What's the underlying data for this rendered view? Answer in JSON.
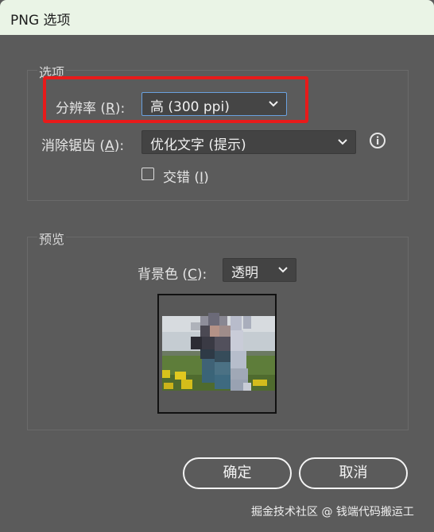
{
  "window": {
    "title": "PNG 选项"
  },
  "options": {
    "group_title": "选项",
    "resolution": {
      "label_prefix": "分辨率 (",
      "label_key": "R",
      "label_suffix": "):",
      "value": "高 (300 ppi)"
    },
    "antialias": {
      "label_prefix": "消除锯齿 (",
      "label_key": "A",
      "label_suffix": "):",
      "value": "优化文字 (提示)"
    },
    "interlace": {
      "label_prefix": "交错 (",
      "label_key": "I",
      "label_suffix": ")",
      "checked": false
    }
  },
  "preview": {
    "group_title": "预览",
    "background": {
      "label_prefix": "背景色 (",
      "label_key": "C",
      "label_suffix": "):",
      "value": "透明"
    }
  },
  "buttons": {
    "ok": "确定",
    "cancel": "取消"
  },
  "watermark": "掘金技术社区 @ 钱端代码搬运工",
  "icons": {
    "info": "info-icon",
    "chevron": "chevron-down-icon",
    "highlight": "#e81a1a",
    "focus": "#6aa1df"
  }
}
